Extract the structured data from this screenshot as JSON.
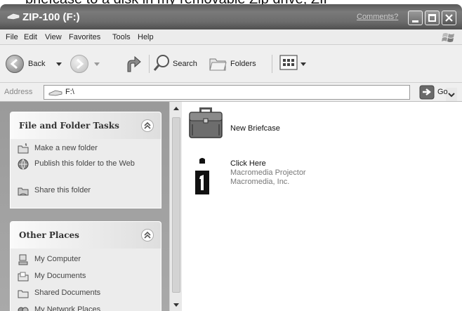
{
  "caption_fragment": "briefcase to a disk in my removable Zip drive, ZIP",
  "window": {
    "title": "ZIP-100 (F:)",
    "comments_link": "Comments?"
  },
  "menu": [
    "File",
    "Edit",
    "View",
    "Favorites",
    "Tools",
    "Help"
  ],
  "toolbar": {
    "back_label": "Back",
    "search_label": "Search",
    "folders_label": "Folders"
  },
  "address": {
    "label": "Address",
    "value": "F:\\",
    "go_label": "Go"
  },
  "task_pane": {
    "file_folder_tasks": {
      "title": "File and Folder Tasks",
      "items": [
        "Make a new folder",
        "Publish this folder to the Web",
        "Share this folder"
      ]
    },
    "other_places": {
      "title": "Other Places",
      "items": [
        "My Computer",
        "My Documents",
        "Shared Documents",
        "My Network Places"
      ]
    }
  },
  "files": [
    {
      "name": "New Briefcase",
      "icon": "briefcase-icon"
    },
    {
      "name": "Click Here",
      "line2": "Macromedia Projector",
      "line3": "Macromedia, Inc.",
      "icon": "projector-icon"
    }
  ],
  "colors": {
    "titlebar": "#6c6c6c",
    "taskpane_bg": "#a2a2a2",
    "panel_bg": "#ececec"
  }
}
